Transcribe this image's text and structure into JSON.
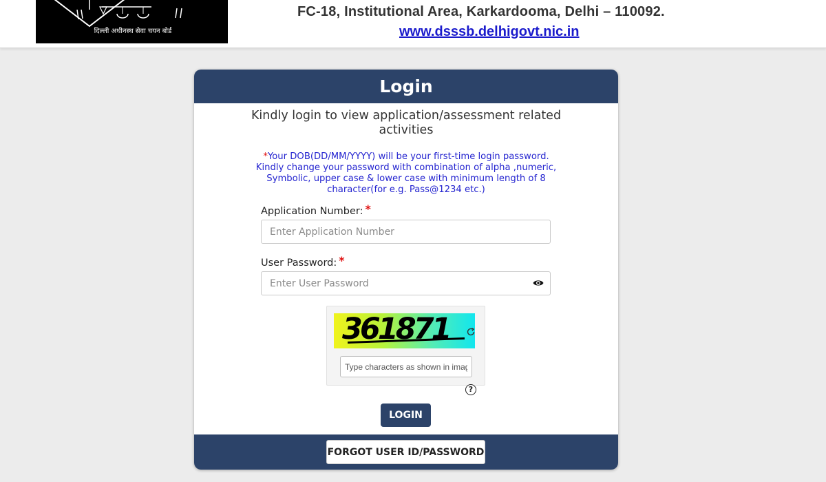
{
  "header": {
    "logo_text": "दिल्ली अधीनस्थ सेवा चयन बोर्ड",
    "address": "FC-18, Institutional Area, Karkardooma, Delhi – 110092.",
    "website": "www.dsssb.delhigovt.nic.in"
  },
  "login": {
    "title": "Login",
    "intro": "Kindly login to view application/assessment related activities",
    "note_star": "*",
    "note": "Your DOB(DD/MM/YYYY) will be your first-time login password. Kindly change your password with combination of alpha ,numeric, Symbolic, upper case & lower case with minimum length of 8 character(for e.g. Pass@1234 etc.)",
    "application_number": {
      "label": "Application Number:",
      "required": "*",
      "placeholder": "Enter Application Number",
      "value": ""
    },
    "password": {
      "label": "User Password:",
      "required": "*",
      "placeholder": "Enter User Password",
      "value": ""
    },
    "captcha": {
      "code": "361871",
      "placeholder": "Type characters as shown in image",
      "help": "?"
    },
    "submit_label": "LOGIN",
    "forgot_label": "FORGOT USER ID/PASSWORD"
  },
  "colors": {
    "primary": "#2c4369",
    "note_text": "#2525d0",
    "required": "#e01010",
    "link": "#1a1acc"
  },
  "icons": [
    "emblem-logo",
    "eye-icon",
    "refresh-icon",
    "help-icon"
  ]
}
